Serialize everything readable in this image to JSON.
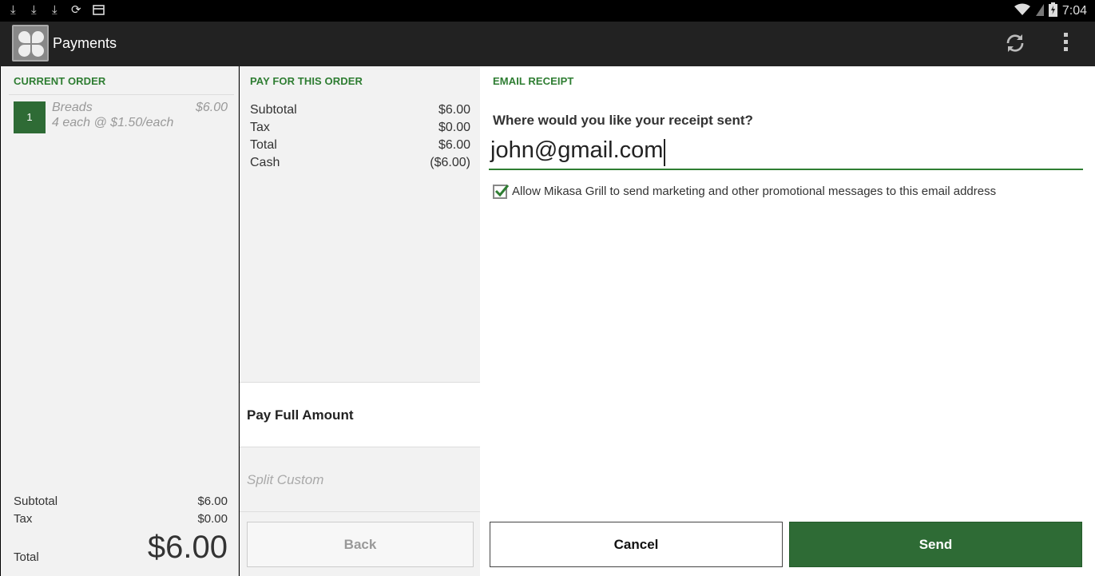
{
  "status_bar": {
    "left_icons": [
      "download-icon",
      "download-icon",
      "download-icon",
      "sync-icon",
      "card-icon"
    ],
    "right_icons": [
      "wifi-icon",
      "signal-icon",
      "battery-charging-icon"
    ],
    "time": "7:04"
  },
  "action_bar": {
    "title": "Payments",
    "icons": [
      "app-logo-icon",
      "refresh-icon",
      "overflow-menu-icon"
    ]
  },
  "current_order": {
    "header": "CURRENT ORDER",
    "items": [
      {
        "qty": "1",
        "name": "Breads",
        "detail": "4 each @ $1.50/each",
        "price": "$6.00"
      }
    ],
    "subtotal_label": "Subtotal",
    "subtotal_value": "$6.00",
    "tax_label": "Tax",
    "tax_value": "$0.00",
    "total_label": "Total",
    "total_value": "$6.00"
  },
  "pay_for_order": {
    "header": "PAY FOR THIS ORDER",
    "rows": [
      {
        "label": "Subtotal",
        "value": "$6.00"
      },
      {
        "label": "Tax",
        "value": "$0.00"
      },
      {
        "label": "Total",
        "value": "$6.00"
      },
      {
        "label": "Cash",
        "value": "($6.00)"
      }
    ],
    "options": [
      "Pay Full Amount",
      "Split Custom"
    ],
    "selected_option": "Pay Full Amount",
    "back_label": "Back"
  },
  "email_receipt": {
    "header": "EMAIL RECEIPT",
    "question": "Where would you like your receipt sent?",
    "email_value": "john@gmail.com",
    "consent_checked": true,
    "consent_label": "Allow Mikasa Grill to send marketing and other promotional messages to this email address",
    "cancel_label": "Cancel",
    "send_label": "Send"
  },
  "colors": {
    "accent_green": "#2e7d32",
    "button_green": "#2e6b35",
    "action_bar": "#222222",
    "panel_gray": "#f2f2f2"
  }
}
